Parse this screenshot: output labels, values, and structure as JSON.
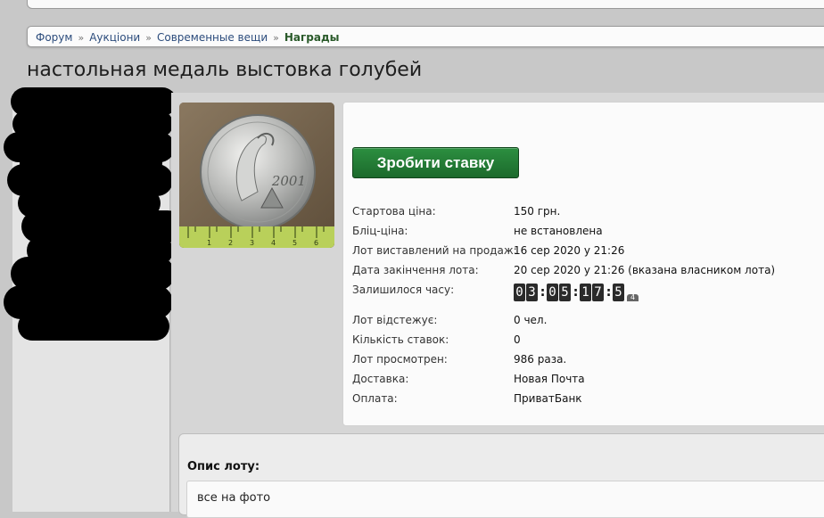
{
  "breadcrumb": {
    "items": [
      "Форум",
      "Аукціони",
      "Современные вещи"
    ],
    "current": "Награды",
    "separator": "»"
  },
  "lot": {
    "title": "настольная медаль выстовка голубей",
    "photo": {
      "ruler_numbers": [
        "1",
        "2",
        "3",
        "4",
        "5",
        "6"
      ],
      "medal_text": "2001"
    },
    "bid_button": "Зробити ставку",
    "fields": [
      {
        "label": "Стартова ціна:",
        "value": "150 грн."
      },
      {
        "label": "Бліц-ціна:",
        "value": "не встановлена"
      },
      {
        "label": "Лот виставлений на продаж:",
        "value": "16 сер 2020 у 21:26"
      },
      {
        "label": "Дата закінчення лота:",
        "value": "20 сер 2020 у 21:26 (вказана власником лота)"
      },
      {
        "label": "Залишилося часу:",
        "value": ""
      },
      {
        "label": "Лот відстежує:",
        "value": "0 чел."
      },
      {
        "label": "Кількість ставок:",
        "value": "0"
      },
      {
        "label": "Лот просмотрен:",
        "value": "986 раза."
      },
      {
        "label": "Доставка:",
        "value": "Новая Почта"
      },
      {
        "label": "Оплата:",
        "value": "ПриватБанк"
      }
    ],
    "timer": {
      "digits": [
        "0",
        "3",
        "0",
        "5",
        "1",
        "7",
        "5"
      ],
      "separator": ":",
      "tab": "4"
    }
  },
  "description": {
    "title": "Опис лоту:",
    "text": "все на фото"
  },
  "colors": {
    "accent_green": "#1f7a33",
    "breadcrumb_current": "#2a5a2a",
    "redaction": "#000000"
  }
}
